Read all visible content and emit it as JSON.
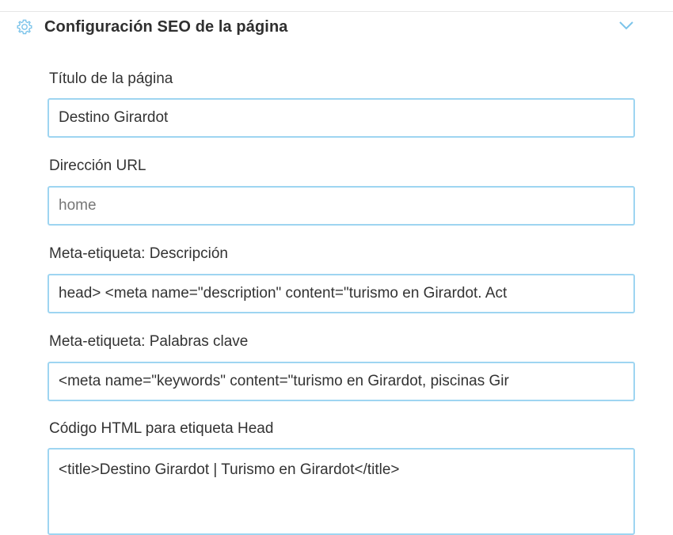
{
  "section": {
    "title": "Configuración SEO de la página",
    "icon": "gear-icon",
    "toggle_icon": "chevron-down-icon",
    "accent_color": "#4fb3e6"
  },
  "fields": {
    "page_title": {
      "label": "Título de la página",
      "value": "Destino Girardot"
    },
    "url": {
      "label": "Dirección URL",
      "placeholder": "home"
    },
    "meta_description": {
      "label": "Meta-etiqueta: Descripción",
      "value": "head> <meta name=\"description\" content=\"turismo en Girardot. Act"
    },
    "meta_keywords": {
      "label": "Meta-etiqueta: Palabras clave",
      "value": "<meta name=\"keywords\" content=\"turismo en Girardot, piscinas Gir"
    },
    "head_html": {
      "label": "Código HTML para etiqueta Head",
      "value": "<title>Destino Girardot | Turismo en Girardot</title>"
    }
  }
}
